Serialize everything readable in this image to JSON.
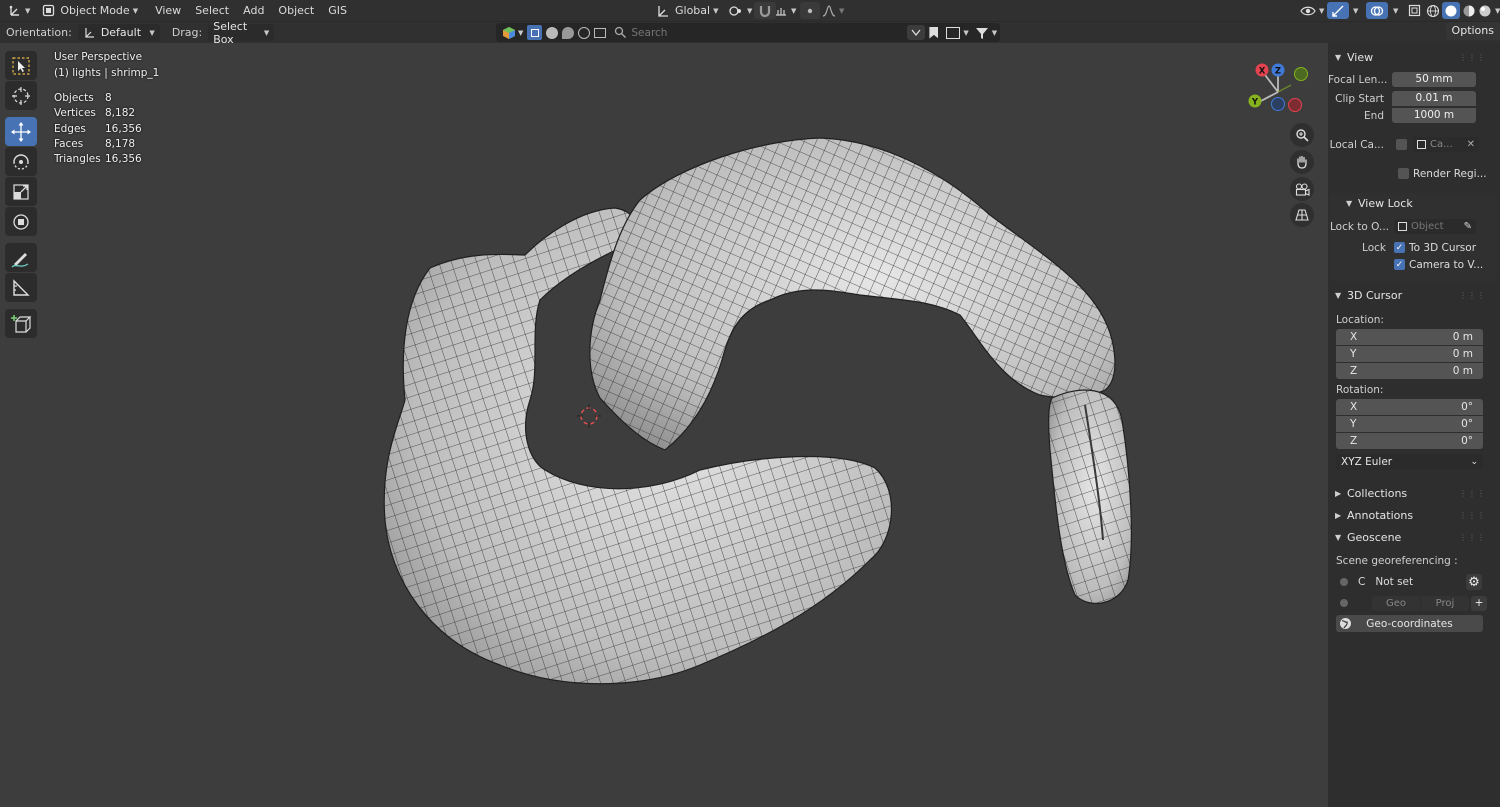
{
  "header": {
    "mode": "Object Mode",
    "menu": [
      "View",
      "Select",
      "Add",
      "Object",
      "GIS"
    ],
    "transform_orientation": "Global"
  },
  "tool_settings": {
    "orientation_label": "Orientation:",
    "orientation_value": "Default",
    "drag_label": "Drag:",
    "drag_value": "Select Box",
    "search_placeholder": "Search",
    "options_label": "Options"
  },
  "viewport": {
    "perspective": "User Perspective",
    "context": "(1) lights | shrimp_1",
    "stats": [
      {
        "label": "Objects",
        "value": "8"
      },
      {
        "label": "Vertices",
        "value": "8,182"
      },
      {
        "label": "Edges",
        "value": "16,356"
      },
      {
        "label": "Faces",
        "value": "8,178"
      },
      {
        "label": "Triangles",
        "value": "16,356"
      }
    ],
    "gizmo": {
      "x": "X",
      "y": "Y",
      "z": "Z"
    }
  },
  "sidebar": {
    "view": {
      "title": "View",
      "focal_label": "Focal Len...",
      "focal_value": "50 mm",
      "clip_start_label": "Clip Start",
      "clip_start_value": "0.01 m",
      "clip_end_label": "End",
      "clip_end_value": "1000 m",
      "local_camera_label": "Local Ca...",
      "local_camera_value": "Ca...",
      "render_region_label": "Render Regi..."
    },
    "view_lock": {
      "title": "View Lock",
      "lock_to_label": "Lock to O...",
      "lock_to_placeholder": "Object",
      "lock_label": "Lock",
      "to_cursor": "To 3D Cursor",
      "camera_to_view": "Camera to V..."
    },
    "cursor": {
      "title": "3D Cursor",
      "location_label": "Location:",
      "location": [
        {
          "axis": "X",
          "value": "0 m"
        },
        {
          "axis": "Y",
          "value": "0 m"
        },
        {
          "axis": "Z",
          "value": "0 m"
        }
      ],
      "rotation_label": "Rotation:",
      "rotation": [
        {
          "axis": "X",
          "value": "0°"
        },
        {
          "axis": "Y",
          "value": "0°"
        },
        {
          "axis": "Z",
          "value": "0°"
        }
      ],
      "rotation_mode": "XYZ Euler"
    },
    "collections": "Collections",
    "annotations": "Annotations",
    "geoscene": {
      "title": "Geoscene",
      "georef_label": "Scene georeferencing :",
      "crs_prefix": "C",
      "crs_value": "Not set",
      "geo_label": "Geo",
      "proj_label": "Proj",
      "geocoords_label": "Geo-coordinates"
    }
  },
  "colors": {
    "accent": "#4772b3",
    "viewport_bg": "#3d3d3d",
    "header_bg": "#303030",
    "axis_x": "#e2434f",
    "axis_y": "#86b21e",
    "axis_z": "#3f7ad8"
  }
}
